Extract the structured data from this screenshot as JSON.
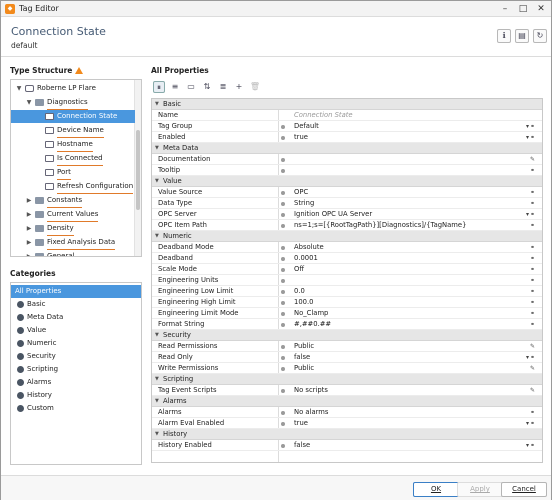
{
  "window": {
    "title": "Tag Editor",
    "accent": "#f28a1c",
    "selection": "#4a97de"
  },
  "header": {
    "tag_name": "Connection State",
    "provider": "default"
  },
  "tree": {
    "title": "Type Structure",
    "nodes": [
      {
        "label": "Roberne LP Flare",
        "level": 0,
        "type": "root",
        "expanded": true
      },
      {
        "label": "Diagnostics",
        "level": 1,
        "type": "folder",
        "expanded": true
      },
      {
        "label": "Connection State",
        "level": 2,
        "type": "tag",
        "selected": true
      },
      {
        "label": "Device Name",
        "level": 2,
        "type": "tag"
      },
      {
        "label": "Hostname",
        "level": 2,
        "type": "tag"
      },
      {
        "label": "Is Connected",
        "level": 2,
        "type": "tag"
      },
      {
        "label": "Port",
        "level": 2,
        "type": "tag"
      },
      {
        "label": "Refresh Configuration",
        "level": 2,
        "type": "tag"
      },
      {
        "label": "Constants",
        "level": 1,
        "type": "folder"
      },
      {
        "label": "Current Values",
        "level": 1,
        "type": "folder"
      },
      {
        "label": "Density",
        "level": 1,
        "type": "folder"
      },
      {
        "label": "Fixed Analysis Data",
        "level": 1,
        "type": "folder"
      },
      {
        "label": "General",
        "level": 1,
        "type": "folder"
      }
    ]
  },
  "categories": {
    "title": "Categories",
    "items": [
      "All Properties",
      "Basic",
      "Meta Data",
      "Value",
      "Numeric",
      "Security",
      "Scripting",
      "Alarms",
      "History",
      "Custom"
    ]
  },
  "properties": {
    "title": "All Properties",
    "rows": [
      {
        "group": "Basic"
      },
      {
        "name": "Name",
        "value": "Connection State",
        "placeholder": true
      },
      {
        "name": "Tag Group",
        "value": "Default",
        "dropdown": true
      },
      {
        "name": "Enabled",
        "value": "true",
        "dropdown": true
      },
      {
        "group": "Meta Data"
      },
      {
        "name": "Documentation",
        "value": "",
        "edit": true
      },
      {
        "name": "Tooltip",
        "value": ""
      },
      {
        "group": "Value"
      },
      {
        "name": "Value Source",
        "value": "OPC"
      },
      {
        "name": "Data Type",
        "value": "String"
      },
      {
        "name": "OPC Server",
        "value": "Ignition OPC UA Server",
        "dropdown": true
      },
      {
        "name": "OPC Item Path",
        "value": "ns=1;s=[{RootTagPath}][Diagnostics]/{TagName}"
      },
      {
        "group": "Numeric"
      },
      {
        "name": "Deadband Mode",
        "value": "Absolute"
      },
      {
        "name": "Deadband",
        "value": "0.0001"
      },
      {
        "name": "Scale Mode",
        "value": "Off"
      },
      {
        "name": "Engineering Units",
        "value": ""
      },
      {
        "name": "Engineering Low Limit",
        "value": "0.0"
      },
      {
        "name": "Engineering High Limit",
        "value": "100.0"
      },
      {
        "name": "Engineering Limit Mode",
        "value": "No_Clamp"
      },
      {
        "name": "Format String",
        "value": "#,##0.##"
      },
      {
        "group": "Security"
      },
      {
        "name": "Read Permissions",
        "value": "Public",
        "edit": true
      },
      {
        "name": "Read Only",
        "value": "false",
        "dropdown": true
      },
      {
        "name": "Write Permissions",
        "value": "Public",
        "edit": true
      },
      {
        "group": "Scripting"
      },
      {
        "name": "Tag Event Scripts",
        "value": "No scripts",
        "edit": true
      },
      {
        "group": "Alarms"
      },
      {
        "name": "Alarms",
        "value": "No alarms"
      },
      {
        "name": "Alarm Eval Enabled",
        "value": "true",
        "dropdown": true
      },
      {
        "group": "History"
      },
      {
        "name": "History Enabled",
        "value": "false",
        "dropdown": true
      }
    ]
  },
  "footer": {
    "ok": "OK",
    "apply": "Apply",
    "cancel": "Cancel"
  }
}
